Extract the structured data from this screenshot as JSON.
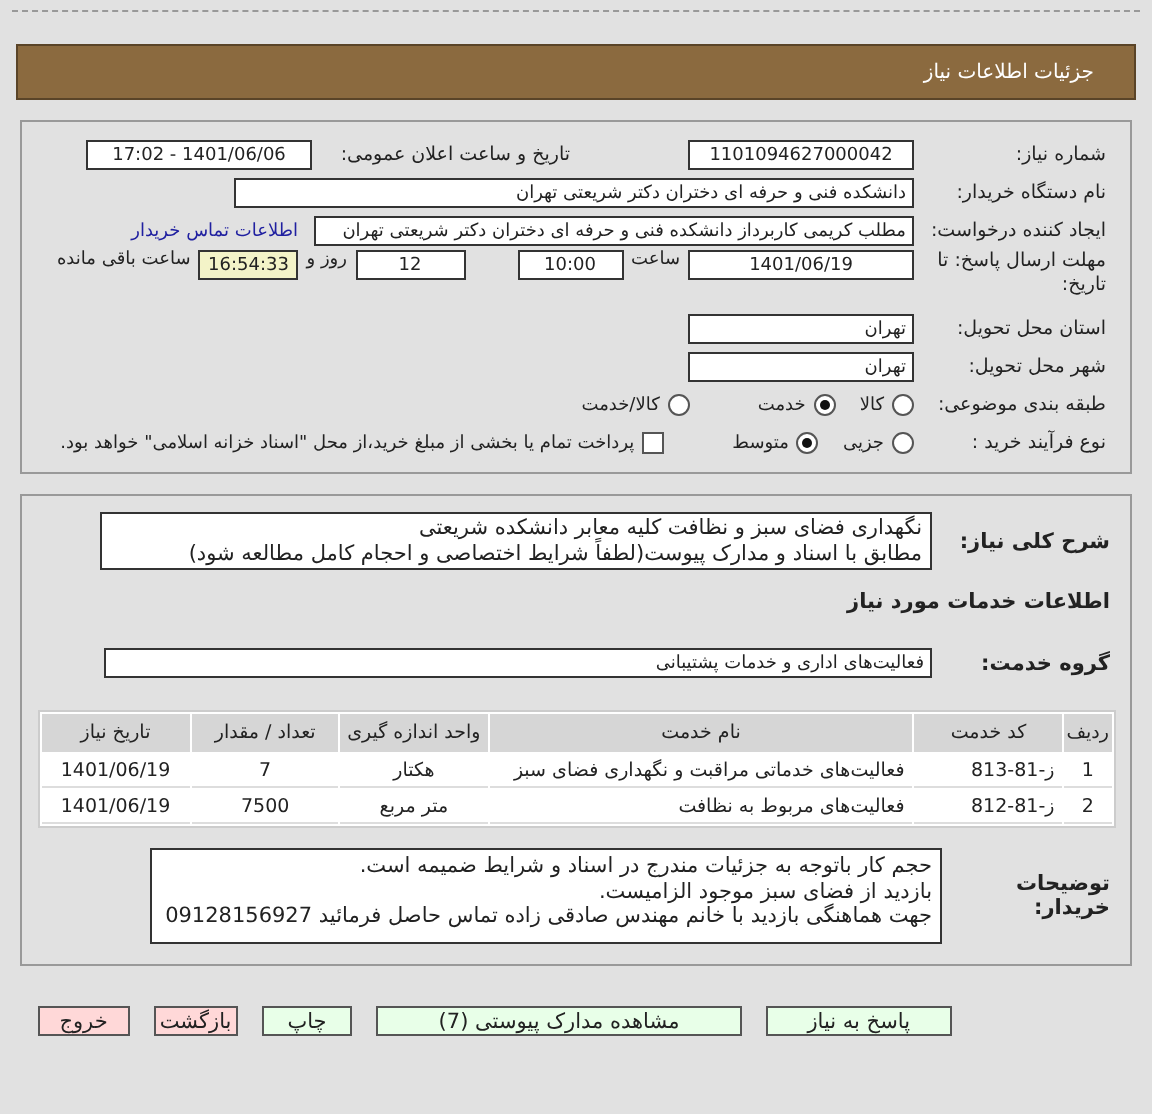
{
  "header": {
    "title": "جزئیات اطلاعات نیاز"
  },
  "need_number": {
    "label": "شماره نیاز:",
    "value": "1101094627000042"
  },
  "announce": {
    "label": "تاریخ و ساعت اعلان عمومی:",
    "value": "1401/06/06 - 17:02"
  },
  "buyer": {
    "label": "نام دستگاه خریدار:",
    "value": "دانشکده فنی و حرفه ای دختران دکتر شریعتی تهران"
  },
  "requester": {
    "label": "ایجاد کننده درخواست:",
    "value": "مطلب کریمی کاربرداز دانشکده فنی و حرفه ای دختران دکتر شریعتی تهران",
    "link": "اطلاعات تماس خریدار"
  },
  "deadline": {
    "label": "مهلت ارسال پاسخ: تا تاریخ:",
    "date": "1401/06/19",
    "time_label": "ساعت",
    "time": "10:00",
    "days": "12",
    "days_label": "روز و",
    "remaining": "16:54:33",
    "remaining_label": "ساعت باقی مانده"
  },
  "province": {
    "label": "استان محل تحویل:",
    "value": "تهران"
  },
  "city": {
    "label": "شهر محل تحویل:",
    "value": "تهران"
  },
  "category": {
    "label": "طبقه بندی موضوعی:",
    "options": [
      {
        "label": "کالا",
        "selected": false
      },
      {
        "label": "خدمت",
        "selected": true
      },
      {
        "label": "کالا/خدمت",
        "selected": false
      }
    ]
  },
  "process": {
    "label": "نوع فرآیند خرید :",
    "options": [
      {
        "label": "جزیی",
        "selected": false
      },
      {
        "label": "متوسط",
        "selected": true
      }
    ],
    "payment": {
      "checked": false,
      "label": "پرداخت تمام یا بخشی از مبلغ خرید،از محل \"اسناد خزانه اسلامی\" خواهد بود."
    }
  },
  "description": {
    "label": "شرح کلی نیاز:",
    "lines": [
      "نگهداری فضای سبز و نظافت کلیه معابر دانشکده شریعتی",
      "مطابق با اسناد و مدارک پیوست(لطفاً شرایط اختصاصی و احجام کامل مطالعه شود)"
    ]
  },
  "services_title": "اطلاعات خدمات مورد نیاز",
  "group": {
    "label": "گروه خدمت:",
    "value": "فعالیت‌های اداری و خدمات پشتیبانی"
  },
  "table": {
    "columns": [
      "ردیف",
      "کد خدمت",
      "نام خدمت",
      "واحد اندازه گیری",
      "تعداد / مقدار",
      "تاریخ نیاز"
    ],
    "rows": [
      [
        "1",
        "ز-81-813",
        "فعالیت‌های خدماتی مراقبت و نگهداری فضای سبز",
        "هکتار",
        "7",
        "1401/06/19"
      ],
      [
        "2",
        "ز-81-812",
        "فعالیت‌های مربوط به نظافت",
        "متر مربع",
        "7500",
        "1401/06/19"
      ]
    ]
  },
  "buyer_notes": {
    "label": "توضیحات خریدار:",
    "lines": [
      "حجم کار باتوجه به جزئیات مندرج در اسناد و شرایط ضمیمه است.",
      "بازدید از فضای سبز موجود الزامیست.",
      "جهت هماهنگی بازدید با خانم مهندس صادقی زاده تماس حاصل فرمائید 09128156927"
    ]
  },
  "buttons": [
    {
      "label": "پاسخ به نیاز",
      "kind": "action"
    },
    {
      "label": "مشاهده مدارک پیوستی (7)",
      "kind": "action"
    },
    {
      "label": "چاپ",
      "kind": "action"
    },
    {
      "label": "بازگشت",
      "kind": "danger"
    },
    {
      "label": "خروج",
      "kind": "danger"
    }
  ]
}
